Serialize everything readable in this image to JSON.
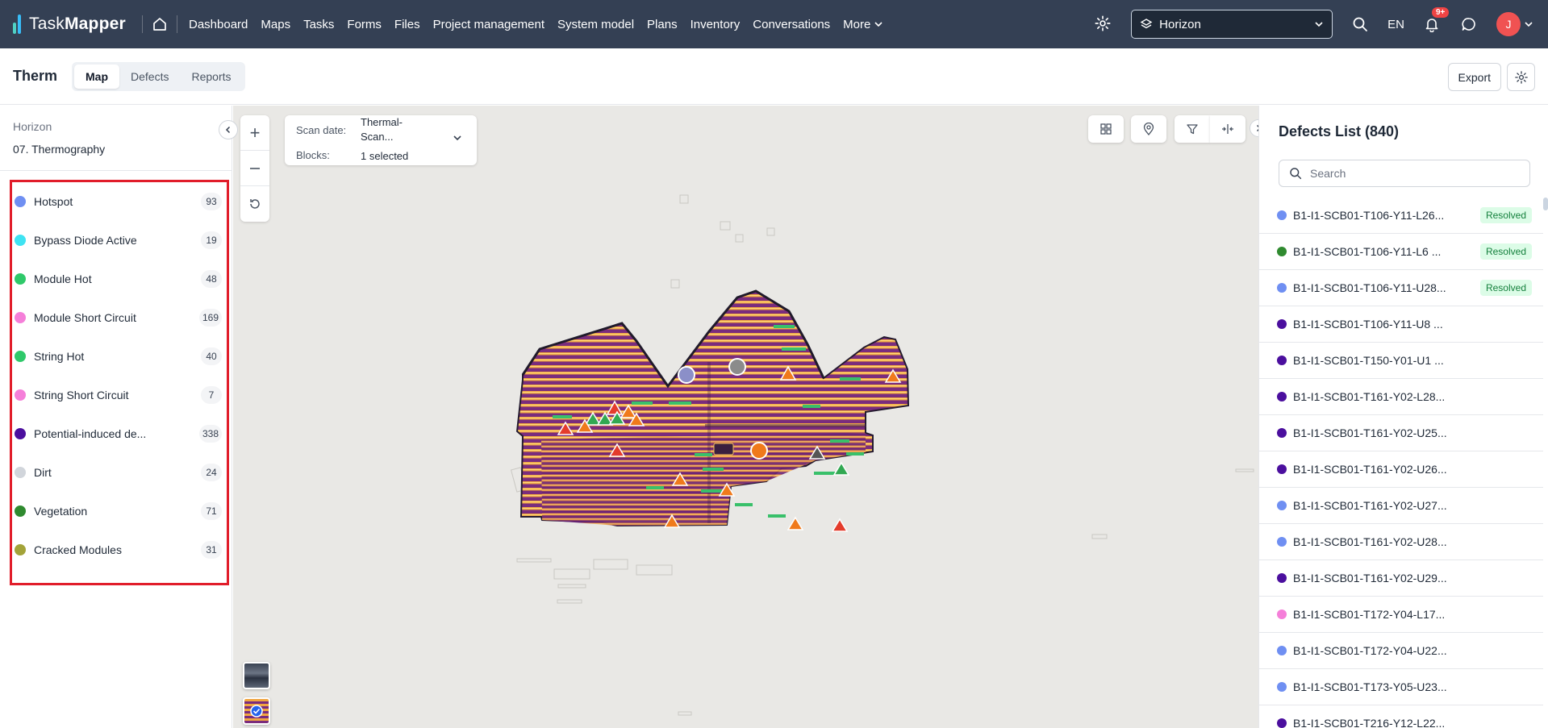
{
  "brand": {
    "name_light": "Task",
    "name_bold": "Mapper"
  },
  "nav": [
    "Dashboard",
    "Maps",
    "Tasks",
    "Forms",
    "Files",
    "Project management",
    "System model",
    "Plans",
    "Inventory",
    "Conversations"
  ],
  "nav_more": "More",
  "project": "Horizon",
  "language": "EN",
  "notifications": "9+",
  "user_initial": "J",
  "app": {
    "title": "Therm",
    "tabs": [
      {
        "label": "Map",
        "active": true
      },
      {
        "label": "Defects",
        "active": false
      },
      {
        "label": "Reports",
        "active": false
      }
    ],
    "export_label": "Export"
  },
  "sidebar": {
    "org": "Horizon",
    "group": "07. Thermography",
    "legend": [
      {
        "label": "Hotspot",
        "count": "93",
        "color": "#6f8ff2"
      },
      {
        "label": "Bypass Diode Active",
        "count": "19",
        "color": "#3fe3f2"
      },
      {
        "label": "Module Hot",
        "count": "48",
        "color": "#2fc96a"
      },
      {
        "label": "Module Short Circuit",
        "count": "169",
        "color": "#f57fd9"
      },
      {
        "label": "String Hot",
        "count": "40",
        "color": "#2fc96a"
      },
      {
        "label": "String Short Circuit",
        "count": "7",
        "color": "#f57fd9"
      },
      {
        "label": "Potential-induced de...",
        "count": "338",
        "color": "#4b0f9e"
      },
      {
        "label": "Dirt",
        "count": "24",
        "color": "#d1d5db"
      },
      {
        "label": "Vegetation",
        "count": "71",
        "color": "#2f8a2f"
      },
      {
        "label": "Cracked Modules",
        "count": "31",
        "color": "#a3a339"
      }
    ]
  },
  "map": {
    "scan_date_label": "Scan date:",
    "scan_date_value_1": "Thermal-",
    "scan_date_value_2": "Scan...",
    "blocks_label": "Blocks:",
    "blocks_value": "1 selected"
  },
  "defects": {
    "title": "Defects List (840)",
    "search_placeholder": "Search",
    "items": [
      {
        "name": "B1-I1-SCB01-T106-Y11-L26...",
        "color": "#6f8ff2",
        "status": "Resolved"
      },
      {
        "name": "B1-I1-SCB01-T106-Y11-L6 ...",
        "color": "#2f8a2f",
        "status": "Resolved"
      },
      {
        "name": "B1-I1-SCB01-T106-Y11-U28...",
        "color": "#6f8ff2",
        "status": "Resolved"
      },
      {
        "name": "B1-I1-SCB01-T106-Y11-U8 ...",
        "color": "#4b0f9e",
        "status": ""
      },
      {
        "name": "B1-I1-SCB01-T150-Y01-U1 ...",
        "color": "#4b0f9e",
        "status": ""
      },
      {
        "name": "B1-I1-SCB01-T161-Y02-L28...",
        "color": "#4b0f9e",
        "status": ""
      },
      {
        "name": "B1-I1-SCB01-T161-Y02-U25...",
        "color": "#4b0f9e",
        "status": ""
      },
      {
        "name": "B1-I1-SCB01-T161-Y02-U26...",
        "color": "#4b0f9e",
        "status": ""
      },
      {
        "name": "B1-I1-SCB01-T161-Y02-U27...",
        "color": "#6f8ff2",
        "status": ""
      },
      {
        "name": "B1-I1-SCB01-T161-Y02-U28...",
        "color": "#6f8ff2",
        "status": ""
      },
      {
        "name": "B1-I1-SCB01-T161-Y02-U29...",
        "color": "#4b0f9e",
        "status": ""
      },
      {
        "name": "B1-I1-SCB01-T172-Y04-L17...",
        "color": "#f57fd9",
        "status": ""
      },
      {
        "name": "B1-I1-SCB01-T172-Y04-U22...",
        "color": "#6f8ff2",
        "status": ""
      },
      {
        "name": "B1-I1-SCB01-T173-Y05-U23...",
        "color": "#6f8ff2",
        "status": ""
      },
      {
        "name": "B1-I1-SCB01-T216-Y12-L22...",
        "color": "#4b0f9e",
        "status": ""
      }
    ]
  }
}
